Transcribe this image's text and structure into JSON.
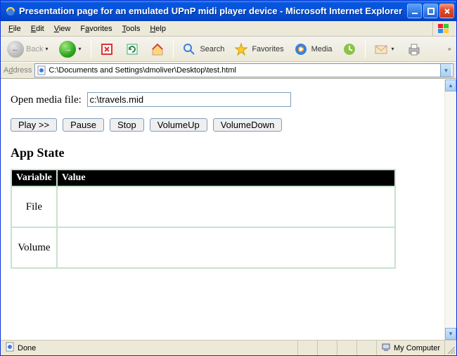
{
  "window": {
    "title": "Presentation page for an emulated UPnP midi player device - Microsoft Internet Explorer"
  },
  "menu": {
    "file": "File",
    "edit": "Edit",
    "view": "View",
    "favorites": "Favorites",
    "tools": "Tools",
    "help": "Help"
  },
  "toolbar": {
    "back": "Back",
    "search": "Search",
    "favorites": "Favorites",
    "media": "Media"
  },
  "address": {
    "label": "Address",
    "value": "C:\\Documents and Settings\\dmoliver\\Desktop\\test.html"
  },
  "page": {
    "open_label": "Open media file:",
    "open_value": "c:\\travels.mid",
    "buttons": {
      "play": "Play >>",
      "pause": "Pause",
      "stop": "Stop",
      "volup": "VolumeUp",
      "voldown": "VolumeDown"
    },
    "heading": "App State",
    "table": {
      "col_variable": "Variable",
      "col_value": "Value",
      "rows": [
        {
          "variable": "File",
          "value": ""
        },
        {
          "variable": "Volume",
          "value": ""
        }
      ]
    }
  },
  "status": {
    "done": "Done",
    "zone": "My Computer"
  }
}
